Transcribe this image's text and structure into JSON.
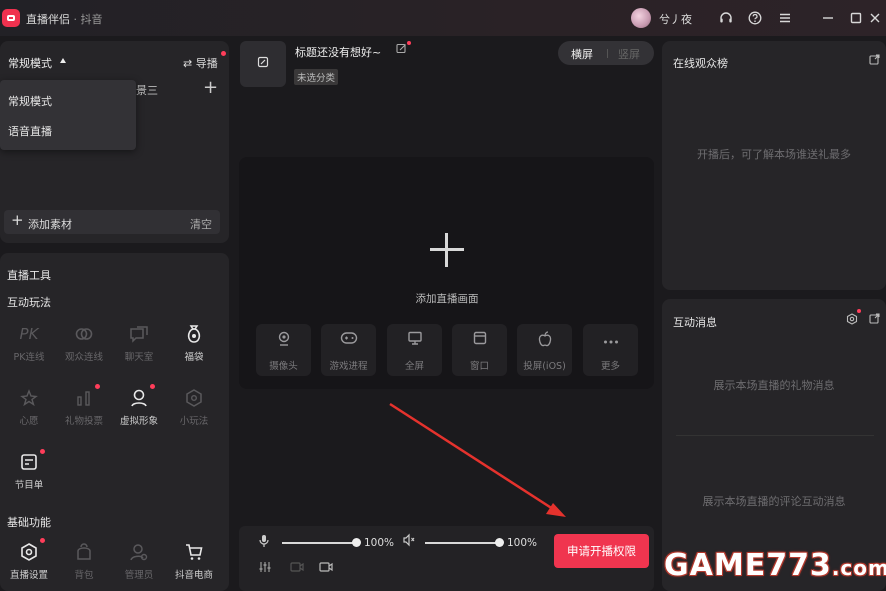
{
  "app": {
    "title": "直播伴侣",
    "separator": " · ",
    "platform": "抖音",
    "user_name": "兮丿夜"
  },
  "left_panel": {
    "mode_label": "常规模式",
    "guide_label": "导播",
    "scene_tab": "景三",
    "dropdown": [
      "常规模式",
      "语音直播"
    ],
    "add_material": "添加素材",
    "clear": "清空"
  },
  "tools": {
    "heading": "直播工具",
    "interactive_heading": "互动玩法",
    "interactive": [
      {
        "label": "PK连线",
        "icon": "PK"
      },
      {
        "label": "观众连线",
        "icon": "link-icon"
      },
      {
        "label": "聊天室",
        "icon": "chat-icon"
      },
      {
        "label": "福袋",
        "icon": "lucky-bag-icon"
      },
      {
        "label": "心愿",
        "icon": "wish-icon"
      },
      {
        "label": "礼物投票",
        "icon": "vote-icon"
      },
      {
        "label": "虚拟形象",
        "icon": "avatar-icon"
      },
      {
        "label": "小玩法",
        "icon": "mini-game-icon"
      },
      {
        "label": "节目单",
        "icon": "program-icon"
      }
    ],
    "basic_heading": "基础功能",
    "basic": [
      {
        "label": "直播设置",
        "icon": "settings-icon"
      },
      {
        "label": "背包",
        "icon": "backpack-icon"
      },
      {
        "label": "管理员",
        "icon": "admin-icon"
      },
      {
        "label": "抖音电商",
        "icon": "cart-icon"
      }
    ]
  },
  "center": {
    "live_title": "标题还没有想好~",
    "category": "未选分类",
    "orientation": {
      "landscape": "横屏",
      "portrait": "竖屏"
    },
    "add_screen": "添加直播画面",
    "sources": [
      {
        "label": "摄像头",
        "icon": "camera-icon"
      },
      {
        "label": "游戏进程",
        "icon": "gamepad-icon"
      },
      {
        "label": "全屏",
        "icon": "monitor-icon"
      },
      {
        "label": "窗口",
        "icon": "window-icon"
      },
      {
        "label": "投屏(iOS)",
        "icon": "apple-icon"
      },
      {
        "label": "更多",
        "icon": "more-icon"
      }
    ],
    "mic_volume": "100%",
    "speaker_volume": "100%",
    "mic_level": 1.0,
    "speaker_level": 1.0,
    "apply_button": "申请开播权限"
  },
  "right_panel": {
    "audience_title": "在线观众榜",
    "audience_empty": "开播后，可了解本场谁送礼最多",
    "messages_title": "互动消息",
    "gift_empty": "展示本场直播的礼物消息",
    "comment_empty": "展示本场直播的评论互动消息"
  },
  "watermark": {
    "text": "GAME773",
    "suffix": ".com"
  },
  "colors": {
    "accent": "#f0354f",
    "background": "#1b1a1d",
    "panel": "#262528"
  }
}
